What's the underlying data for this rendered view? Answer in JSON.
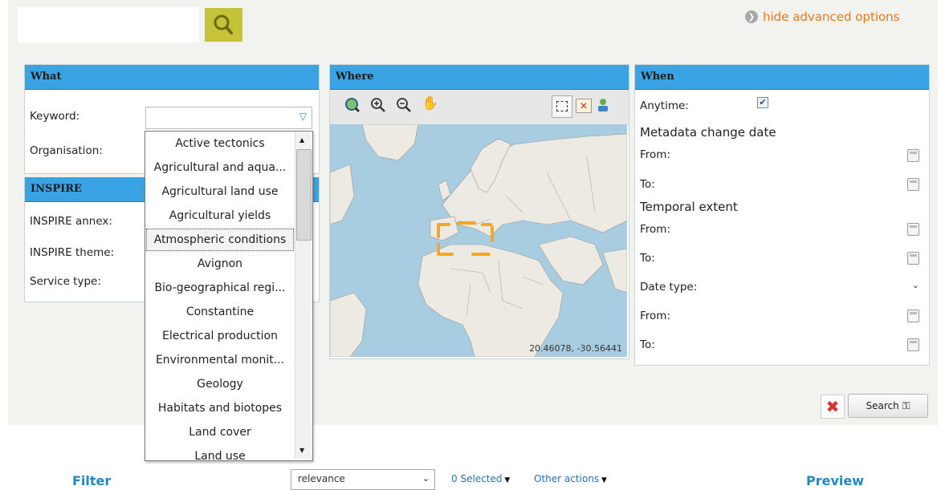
{
  "search": {
    "query": ""
  },
  "header": {
    "advanced_link": "hide advanced options"
  },
  "what": {
    "title": "What",
    "keyword_label": "Keyword:",
    "organisation_label": "Organisation:"
  },
  "inspire": {
    "title": "INSPIRE",
    "annex_label": "INSPIRE annex:",
    "theme_label": "INSPIRE theme:",
    "service_type_label": "Service type:"
  },
  "keyword_dropdown": {
    "items": [
      "Active tectonics",
      "Agricultural and aqua...",
      "Agricultural land use",
      "Agricultural yields",
      "Atmospheric conditions",
      "Avignon",
      "Bio-geographical regi...",
      "Constantine",
      "Electrical production",
      "Environmental monit...",
      "Geology",
      "Habitats and biotopes",
      "Land cover",
      "Land use"
    ],
    "highlighted": "Atmospheric conditions"
  },
  "where": {
    "title": "Where",
    "coordinates": "20.46078, -30.56441"
  },
  "when": {
    "title": "When",
    "anytime_label": "Anytime:",
    "anytime_checked": true,
    "metadata_change_heading": "Metadata change date",
    "from_label": "From:",
    "to_label": "To:",
    "temporal_extent_heading": "Temporal extent",
    "date_type_label": "Date type:"
  },
  "actions": {
    "search_label": "Search"
  },
  "bottom": {
    "filter_label": "Filter",
    "sort_value": "relevance",
    "selected_label": "0 Selected",
    "other_actions_label": "Other actions",
    "preview_label": "Preview"
  },
  "colors": {
    "header_blue": "#3aa3e3",
    "accent_orange": "#e8781c",
    "search_btn": "#c6c33a"
  }
}
